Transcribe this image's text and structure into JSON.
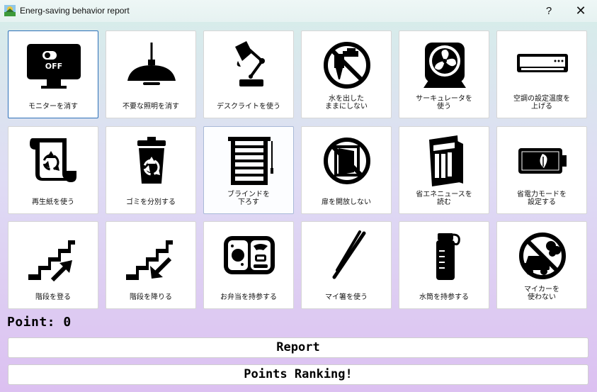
{
  "window": {
    "title": "Energ-saving behavior report",
    "help_label": "?",
    "close_label": "✕"
  },
  "actions": [
    {
      "label": "モニターを消す",
      "icon": "monitor-off-icon"
    },
    {
      "label": "不要な照明を消す",
      "icon": "ceiling-lamp-icon"
    },
    {
      "label": "デスクライトを使う",
      "icon": "desk-lamp-icon"
    },
    {
      "label": "水を出した\nままにしない",
      "icon": "no-faucet-icon"
    },
    {
      "label": "サーキュレータを\n使う",
      "icon": "circulator-fan-icon"
    },
    {
      "label": "空調の設定温度を\n上げる",
      "icon": "air-conditioner-icon"
    },
    {
      "label": "再生紙を使う",
      "icon": "recycled-paper-icon"
    },
    {
      "label": "ゴミを分別する",
      "icon": "recycle-bin-icon"
    },
    {
      "label": "ブラインドを\n下ろす",
      "icon": "blinds-icon"
    },
    {
      "label": "扉を開放しない",
      "icon": "no-open-door-icon"
    },
    {
      "label": "省エネニュースを\n読む",
      "icon": "newspaper-icon"
    },
    {
      "label": "省電力モードを\n設定する",
      "icon": "eco-battery-icon"
    },
    {
      "label": "階段を登る",
      "icon": "stairs-up-icon"
    },
    {
      "label": "階段を降りる",
      "icon": "stairs-down-icon"
    },
    {
      "label": "お弁当を持参する",
      "icon": "bento-box-icon"
    },
    {
      "label": "マイ箸を使う",
      "icon": "chopsticks-icon"
    },
    {
      "label": "水筒を持参する",
      "icon": "water-bottle-icon"
    },
    {
      "label": "マイカーを\n使わない",
      "icon": "no-car-icon"
    }
  ],
  "monitor_text": "OFF",
  "points": {
    "label": "Point: 0"
  },
  "buttons": {
    "report": "Report",
    "ranking": "Points Ranking!"
  }
}
